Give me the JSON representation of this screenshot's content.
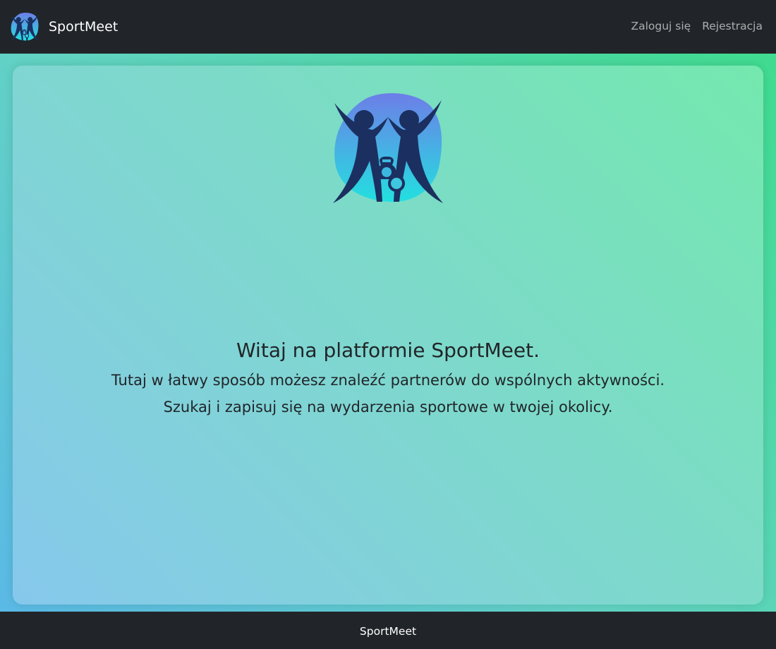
{
  "navbar": {
    "brand_name": "SportMeet",
    "links": [
      {
        "label": "Zaloguj się"
      },
      {
        "label": "Rejestracja"
      }
    ]
  },
  "hero": {
    "logo_icon": "people-high-five-kettlebell-icon",
    "title": "Witaj na platformie SportMeet.",
    "line1": "Tutaj w łatwy sposób możesz znaleźć partnerów do wspólnych aktywności.",
    "line2": "Szukaj i zapisuj się na wydarzenia sportowe w twojej okolicy."
  },
  "footer": {
    "text": "SportMeet"
  },
  "colors": {
    "navbar_bg": "#212529",
    "nav_link": "#a6a8aa",
    "text_dark": "#212529",
    "logo_gradient_top": "#6d7ee8",
    "logo_gradient_bottom": "#22e0e0",
    "figure_color": "#1b3060"
  }
}
